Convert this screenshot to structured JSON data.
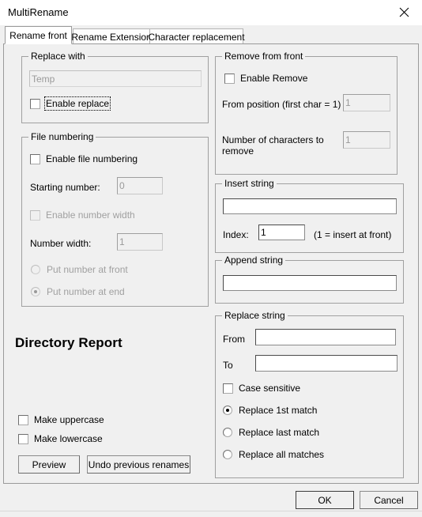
{
  "window": {
    "title": "MultiRename",
    "close_icon": "close-icon"
  },
  "tabs": [
    {
      "label": "Rename front",
      "active": true
    },
    {
      "label": "Rename Extension",
      "active": false
    },
    {
      "label": "Character replacement",
      "active": false
    }
  ],
  "replace_with": {
    "group_title": "Replace with",
    "field_value": "Temp",
    "enable_label": "Enable replace",
    "enabled": false
  },
  "file_numbering": {
    "group_title": "File numbering",
    "enable_label": "Enable file numbering",
    "starting_number_label": "Starting number:",
    "starting_number_value": "0",
    "enable_number_width_label": "Enable number width",
    "number_width_label": "Number width:",
    "number_width_value": "1",
    "radio_front_label": "Put number at front",
    "radio_end_label": "Put number at end",
    "selected_radio": "end"
  },
  "directory_report": {
    "heading": "Directory Report",
    "make_uppercase_label": "Make uppercase",
    "make_lowercase_label": "Make lowercase",
    "preview_button": "Preview",
    "undo_button": "Undo previous renames"
  },
  "remove_from_front": {
    "group_title": "Remove from front",
    "enable_label": "Enable Remove",
    "from_position_label": "From position (first char = 1)",
    "from_position_value": "1",
    "num_chars_label": "Number of characters to remove",
    "num_chars_value": "1"
  },
  "insert_string": {
    "group_title": "Insert string",
    "text_value": "",
    "index_label": "Index:",
    "index_value": "1",
    "hint": "(1 = insert at front)"
  },
  "append_string": {
    "group_title": "Append string",
    "text_value": ""
  },
  "replace_string": {
    "group_title": "Replace string",
    "from_label": "From",
    "from_value": "",
    "to_label": "To",
    "to_value": "",
    "case_sensitive_label": "Case sensitive",
    "radio_first_label": "Replace 1st match",
    "radio_last_label": "Replace last match",
    "radio_all_label": "Replace all matches",
    "selected_radio": "first"
  },
  "footer": {
    "ok_label": "OK",
    "cancel_label": "Cancel"
  }
}
